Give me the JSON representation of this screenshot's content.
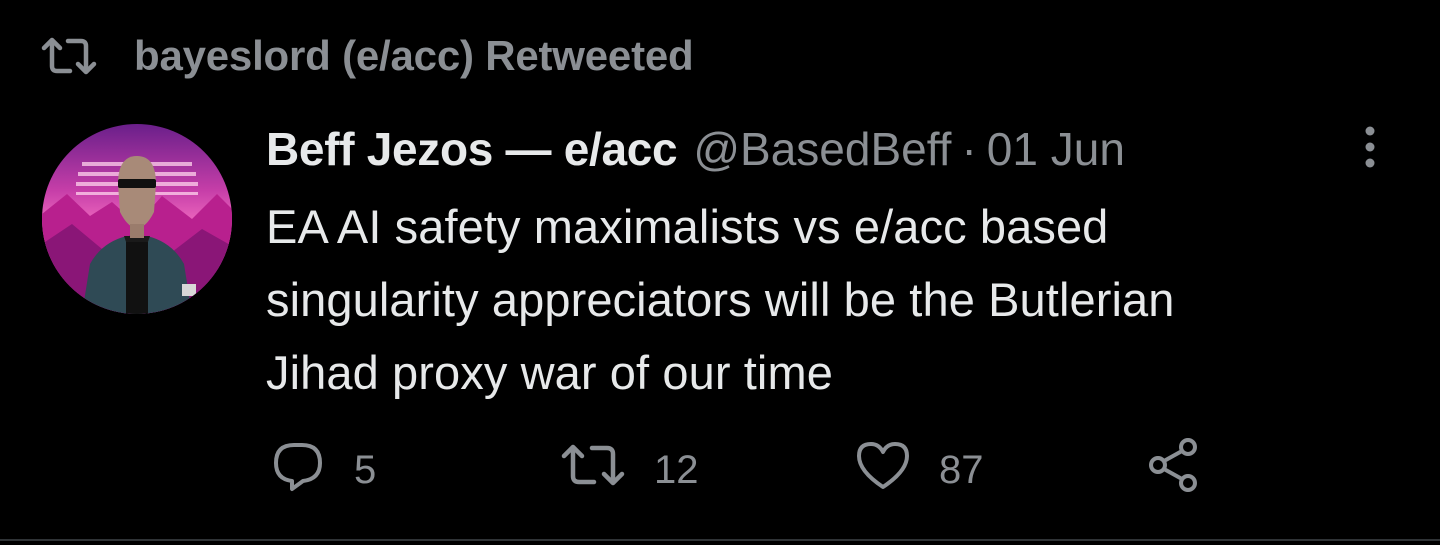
{
  "retweet_header": {
    "icon": "retweet-icon",
    "text": "bayeslord (e/acc) Retweeted"
  },
  "tweet": {
    "author": {
      "display_name": "Beff Jezos — e/acc",
      "handle": "@BasedBeff",
      "avatar": "avatar-pixel-art"
    },
    "separator": "·",
    "date": "01 Jun",
    "more_icon": "more-vertical-icon",
    "text_lines": [
      "EA AI safety maximalists vs e/acc based",
      "singularity appreciators will be the Butlerian",
      "Jihad proxy war of our time"
    ],
    "actions": {
      "reply": {
        "icon": "reply-icon",
        "count": "5"
      },
      "retweet": {
        "icon": "retweet-icon",
        "count": "12"
      },
      "like": {
        "icon": "heart-icon",
        "count": "87"
      },
      "share": {
        "icon": "share-icon"
      }
    }
  },
  "colors": {
    "background": "#000000",
    "primary_text": "#e7e9ea",
    "secondary_text": "#8b8f94",
    "divider": "#2f3336"
  }
}
